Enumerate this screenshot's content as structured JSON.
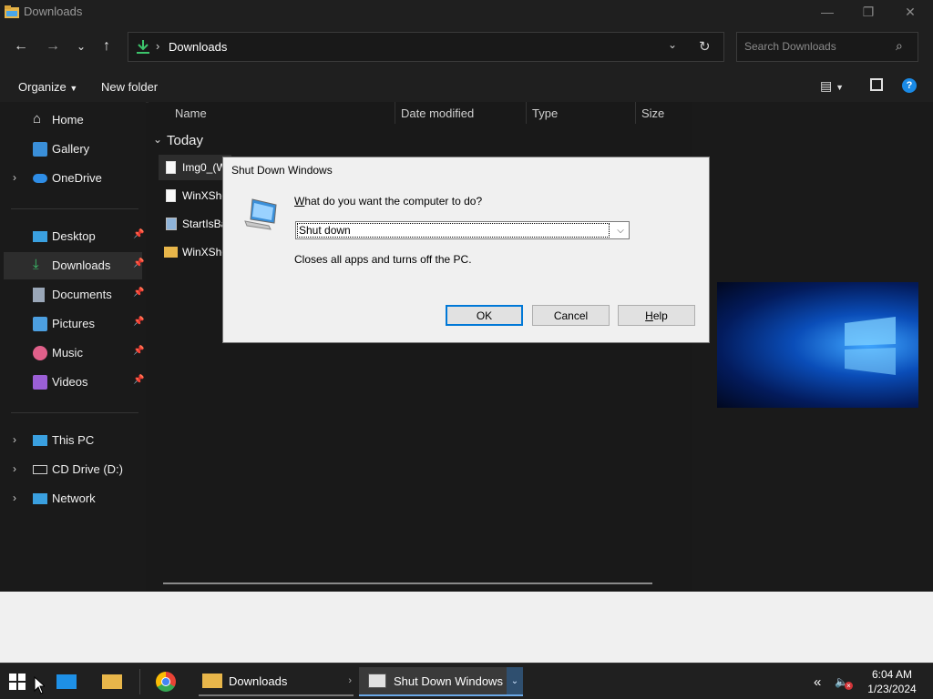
{
  "window": {
    "title": "Downloads",
    "minimize_icon": "minimize-icon",
    "maximize_icon": "restore-icon",
    "close_icon": "close-icon"
  },
  "nav": {
    "breadcrumb_separator": "›",
    "location": "Downloads",
    "search_placeholder": "Search Downloads"
  },
  "command_bar": {
    "organize_label": "Organize",
    "new_folder_label": "New folder"
  },
  "sidebar": {
    "top_items": [
      {
        "label": "Home"
      },
      {
        "label": "Gallery"
      },
      {
        "label": "OneDrive"
      }
    ],
    "quick_access": [
      {
        "label": "Desktop",
        "pinned": true
      },
      {
        "label": "Downloads",
        "pinned": true,
        "active": true
      },
      {
        "label": "Documents",
        "pinned": true
      },
      {
        "label": "Pictures",
        "pinned": true
      },
      {
        "label": "Music",
        "pinned": true
      },
      {
        "label": "Videos",
        "pinned": true
      }
    ],
    "devices": [
      {
        "label": "This PC"
      },
      {
        "label": "CD Drive (D:)"
      },
      {
        "label": "Network"
      }
    ],
    "pin_glyph": "📌"
  },
  "file_list": {
    "columns": [
      "Name",
      "Date modified",
      "Type",
      "Size"
    ],
    "group_label": "Today",
    "rows": [
      {
        "name": "Img0_(W"
      },
      {
        "name": "WinXShe"
      },
      {
        "name": "StartIsBa"
      },
      {
        "name": "WinXShe"
      }
    ]
  },
  "dialog": {
    "title": "Shut Down Windows",
    "question_prefix": "W",
    "question_rest": "hat do you want the computer to do?",
    "selected_option": "Shut down",
    "description": "Closes all apps and turns off the PC.",
    "ok_label": "OK",
    "cancel_label": "Cancel",
    "help_prefix": "H",
    "help_rest": "elp"
  },
  "taskbar": {
    "items": [
      {
        "label": "Downloads"
      },
      {
        "label": "Shut Down Windows"
      }
    ],
    "time": "6:04 AM",
    "date": "1/23/2024"
  },
  "colors": {
    "accent": "#0078d7",
    "explorer_bg": "#191919",
    "dialog_bg": "#f0f0f0"
  }
}
